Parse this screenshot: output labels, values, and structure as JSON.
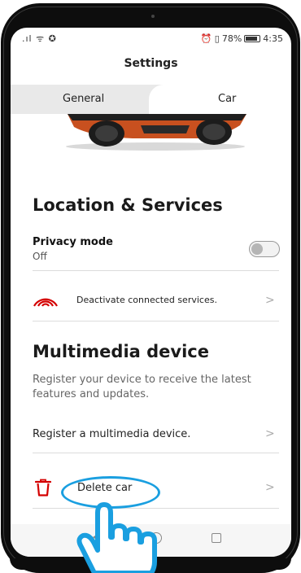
{
  "status_bar": {
    "signal_icons": ".ıl ᯤ ✪",
    "system_icons": "⏰ ▯",
    "battery_percent": "78%",
    "time": "4:35"
  },
  "header": {
    "title": "Settings"
  },
  "tabs": [
    {
      "label": "General",
      "selected": false
    },
    {
      "label": "Car",
      "selected": true
    }
  ],
  "location_services": {
    "title": "Location & Services",
    "privacy_mode": {
      "label": "Privacy mode",
      "value": "Off",
      "enabled": false
    },
    "deactivate": {
      "label": "Deactivate connected services."
    }
  },
  "multimedia": {
    "title": "Multimedia device",
    "description": "Register your device to receive the latest features and updates.",
    "register": {
      "label": "Register a multimedia device."
    }
  },
  "delete_car": {
    "label": "Delete car"
  },
  "chevron": ">",
  "colors": {
    "accent_red": "#d40000",
    "highlight_blue": "#1a9fe0",
    "car_orange": "#c8501f"
  },
  "icons": {
    "connected_services": "wifi-signal-icon",
    "delete": "trash-icon",
    "pointer": "hand-pointer-icon"
  }
}
